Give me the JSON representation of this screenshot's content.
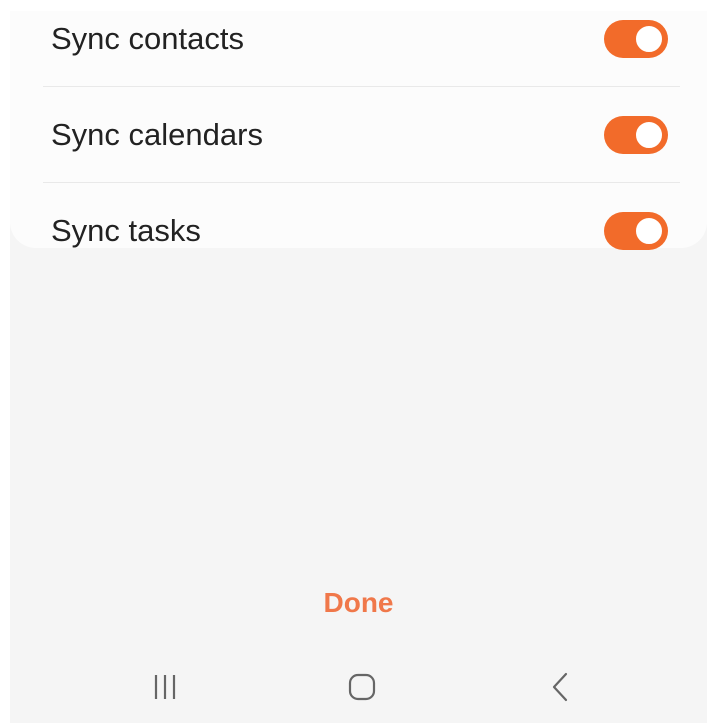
{
  "settings": {
    "items": [
      {
        "label": "Sync contacts",
        "enabled": true
      },
      {
        "label": "Sync calendars",
        "enabled": true
      },
      {
        "label": "Sync tasks",
        "enabled": true
      }
    ]
  },
  "footer": {
    "done_label": "Done"
  },
  "nav": {
    "recents_icon": "recent-apps-icon",
    "home_icon": "home-icon",
    "back_icon": "back-icon"
  },
  "colors": {
    "accent": "#f26b2a",
    "done_text": "#f0784a",
    "background": "#f5f5f5",
    "card": "#fcfcfc"
  }
}
